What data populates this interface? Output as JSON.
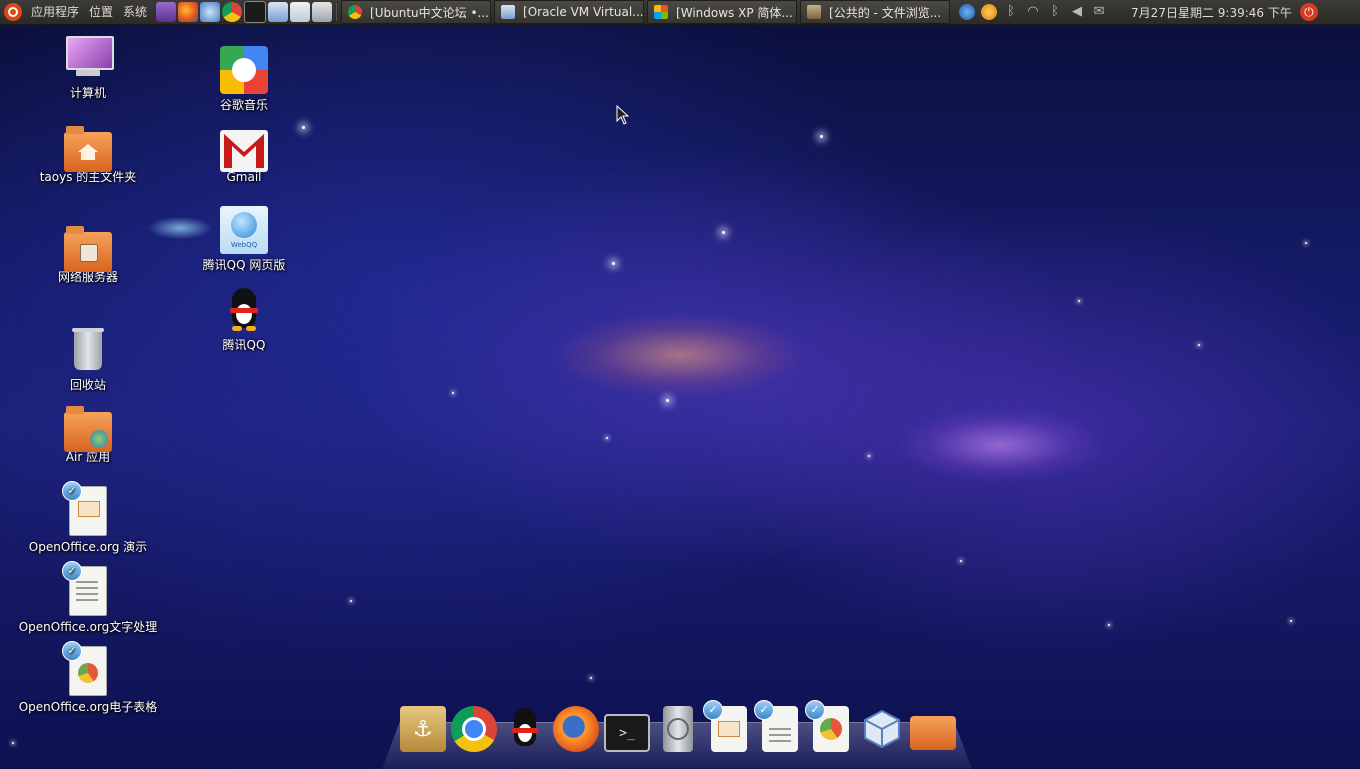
{
  "panel": {
    "menus": [
      "应用程序",
      "位置",
      "系统"
    ],
    "tasks": [
      "[Ubuntu中文论坛 •...",
      "[Oracle VM Virtual...",
      "[Windows XP 简体...",
      "[公共的 - 文件浏览..."
    ],
    "clock": "7月27日星期二  9:39:46 下午"
  },
  "desktop": {
    "left_column": [
      "计算机",
      "taoys 的主文件夹",
      "网络服务器",
      "回收站",
      "Air 应用",
      "OpenOffice.org 演示",
      "OpenOffice.org文字处理",
      "OpenOffice.org电子表格"
    ],
    "right_column": [
      "谷歌音乐",
      "Gmail",
      "腾讯QQ 网页版",
      "腾讯QQ"
    ],
    "webqq_caption": "WebQQ"
  },
  "dock": {
    "terminal_glyph": ">_"
  },
  "colors": {
    "panel_bg": "#3c3b37",
    "ubuntu_orange": "#dd4814",
    "folder_orange": "#e8823a"
  }
}
